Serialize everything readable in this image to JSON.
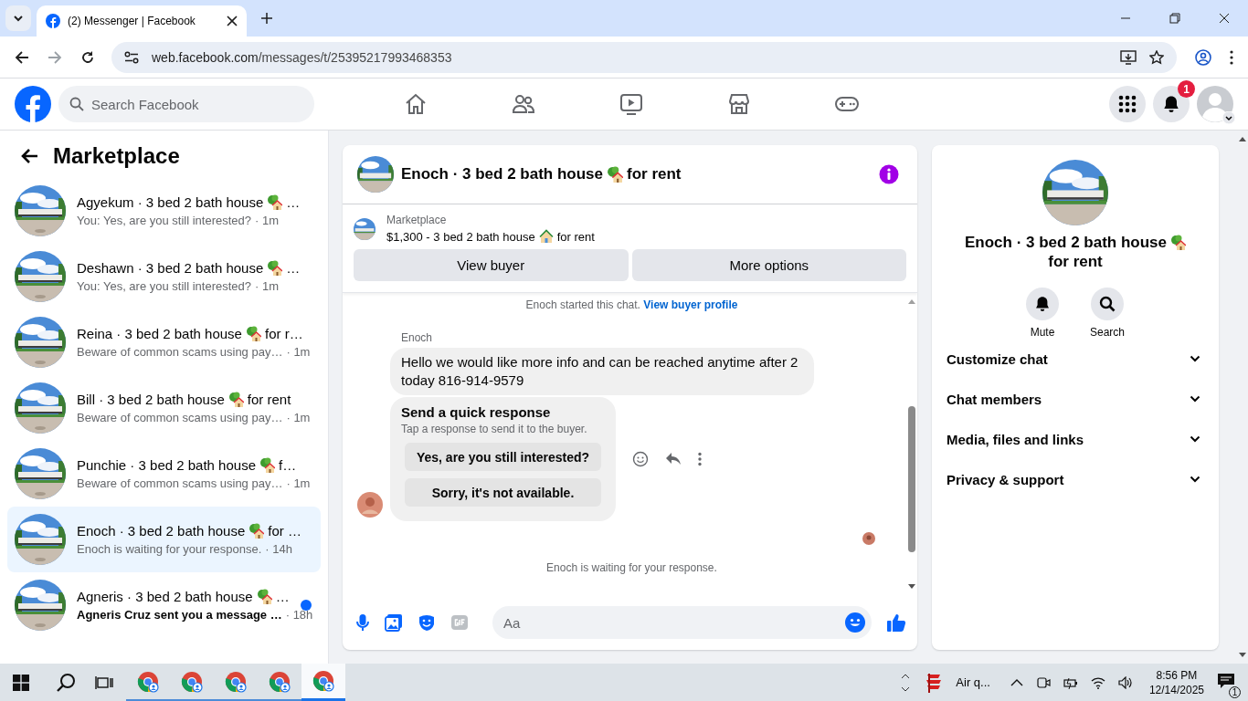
{
  "browser": {
    "tab_title": "(2) Messenger | Facebook",
    "url_host": "web.facebook.com",
    "url_path": "/messages/t/25395217993468353"
  },
  "header": {
    "search_placeholder": "Search Facebook",
    "nav": [
      {
        "kind": "home",
        "selected": false
      },
      {
        "kind": "friends",
        "selected": false
      },
      {
        "kind": "video",
        "selected": false
      },
      {
        "kind": "market",
        "selected": false
      },
      {
        "kind": "gaming",
        "selected": false
      }
    ],
    "notification_badge": "1"
  },
  "sidebar": {
    "title": "Marketplace",
    "conversations": [
      {
        "name": "Agyekum · 3 bed 2 bath house",
        "tail": "…",
        "preview": "You: Yes, are you still interested?",
        "time": "· 1m",
        "selected": false,
        "unread": false
      },
      {
        "name": "Deshawn · 3 bed 2 bath house",
        "tail": "…",
        "preview": "You: Yes, are you still interested?",
        "time": "· 1m",
        "selected": false,
        "unread": false
      },
      {
        "name": "Reina · 3 bed 2 bath house",
        "tail": "for r…",
        "preview": "Beware of common scams using pay…",
        "time": "· 1m",
        "selected": false,
        "unread": false
      },
      {
        "name": "Bill · 3 bed 2 bath house",
        "tail": "for rent",
        "preview": "Beware of common scams using pay…",
        "time": "· 1m",
        "selected": false,
        "unread": false
      },
      {
        "name": "Punchie · 3 bed 2 bath house",
        "tail": "f…",
        "preview": "Beware of common scams using pay…",
        "time": "· 1m",
        "selected": false,
        "unread": false
      },
      {
        "name": "Enoch · 3 bed 2 bath house",
        "tail": "for …",
        "preview": "Enoch is waiting for your response.",
        "time": "· 14h",
        "selected": true,
        "unread": false
      },
      {
        "name": "Agneris · 3 bed 2 bath house",
        "tail": "…",
        "preview": "Agneris Cruz sent you a message …",
        "time": "· 18h",
        "selected": false,
        "unread": true
      }
    ]
  },
  "chat": {
    "title": "Enoch · 3 bed 2 bath house",
    "title_tail": "for rent",
    "listing_label": "Marketplace",
    "listing_price": "$1,300 - 3 bed 2 bath house",
    "listing_tail": "for rent",
    "buttons": [
      "View buyer",
      "More options"
    ],
    "started_text": "Enoch started this chat.",
    "started_link": "View buyer profile",
    "sender": "Enoch",
    "message": "Hello we would like more info and can be reached anytime after 2 today 816-914-9579",
    "quick_title": "Send a quick response",
    "quick_subtitle": "Tap a response to send it to the buyer.",
    "quick_options": [
      "Yes, are you still interested?",
      "Sorry, it's not available."
    ],
    "status": "Enoch is waiting for your response.",
    "composer_placeholder": "Aa"
  },
  "details": {
    "title": "Enoch · 3 bed 2 bath house",
    "title_tail": "for rent",
    "actions": [
      {
        "kind": "mute",
        "label": "Mute"
      },
      {
        "kind": "search",
        "label": "Search"
      }
    ],
    "sections": [
      "Customize chat",
      "Chat members",
      "Media, files and links",
      "Privacy & support"
    ]
  },
  "taskbar": {
    "apps": [
      {
        "selected": false
      },
      {
        "selected": false
      },
      {
        "selected": false
      },
      {
        "selected": false
      },
      {
        "selected": true
      }
    ],
    "weather": "Air q...",
    "time": "8:56 PM",
    "date": "12/14/2025",
    "notifications": "1"
  }
}
